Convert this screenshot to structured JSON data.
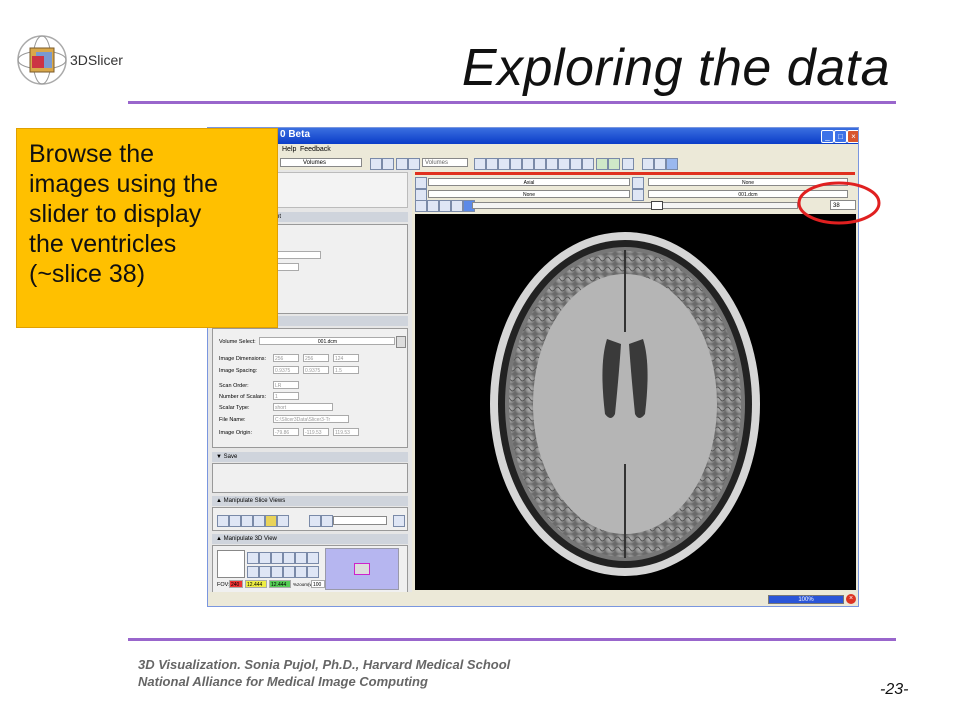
{
  "slide": {
    "title": "Exploring the data",
    "logo_text": "3DSlicer",
    "footer_line1": "3D Visualization. Sonia Pujol, Ph.D., Harvard Medical School",
    "footer_line2": "National Alliance for Medical Image Computing",
    "page_number": "-23-",
    "accent_color": "#9966cc"
  },
  "callout": {
    "lines": [
      "Browse the",
      "images using the",
      "slider to display",
      "the ventricles",
      "(~slice 38)"
    ],
    "background": "#ffc000"
  },
  "app": {
    "title_suffix": "0 Beta",
    "menu": [
      "Help",
      "Feedback"
    ],
    "module_select": "Volumes",
    "search_placeholder": "Volumes",
    "viewer": {
      "orientation": "Axial",
      "background_layer": "None",
      "foreground_layer": "None",
      "label_layer": "None",
      "volume_layer": "001.dcm",
      "slice_value": "38",
      "slice_fraction": 0.57
    },
    "panel": {
      "volume_select_label": "Volume Select:",
      "volume_select_value": "001.dcm",
      "fields": [
        {
          "label": "Image Dimensions:",
          "values": [
            "256",
            "256",
            "124"
          ]
        },
        {
          "label": "Image Spacing:",
          "values": [
            "0.9375",
            "0.9375",
            "1.5"
          ]
        },
        {
          "label": "Scan Order:",
          "values": [
            "LR"
          ]
        },
        {
          "label": "Number of Scalars:",
          "values": [
            "1"
          ]
        },
        {
          "label": "Scalar Type:",
          "values": [
            "short"
          ]
        },
        {
          "label": "File Name:",
          "values": [
            "C:\\Slicer3Data\\Slicer3-Tr"
          ]
        },
        {
          "label": "Image Origin:",
          "values": [
            "-79.86",
            "-119.53",
            "119.53"
          ]
        }
      ],
      "save_section": "Save",
      "manipulate_slice_views": "Manipulate Slice Views",
      "manipulate_3d_view": "Manipulate 3D View",
      "header_fragment": "nt",
      "fov_label": "FOV:",
      "fov_values": [
        "240",
        "12.444",
        "12.444"
      ],
      "zoom_label": "%zoom(wtn)",
      "zoom_value": "100"
    },
    "status": {
      "progress_text": "100%"
    }
  }
}
